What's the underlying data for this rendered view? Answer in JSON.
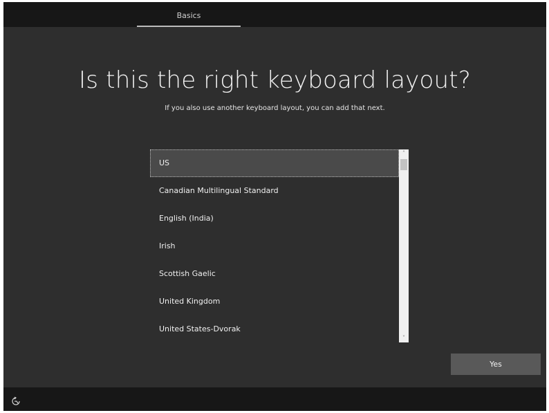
{
  "header": {
    "tab_label": "Basics"
  },
  "main": {
    "title": "Is this the right keyboard layout?",
    "subtitle": "If you also use another keyboard layout, you can add that next."
  },
  "layouts": {
    "selected": "US",
    "items": [
      "US",
      "Canadian Multilingual Standard",
      "English (India)",
      "Irish",
      "Scottish Gaelic",
      "United Kingdom",
      "United States-Dvorak"
    ]
  },
  "scrollbar": {
    "up_glyph": "˄",
    "down_glyph": "˅"
  },
  "actions": {
    "yes_label": "Yes"
  },
  "footer": {
    "accessibility_icon": "ease-of-access-icon"
  },
  "colors": {
    "background": "#2e2e2e",
    "bar": "#171717",
    "selected_item": "#4a4a4a",
    "button": "#595959"
  }
}
